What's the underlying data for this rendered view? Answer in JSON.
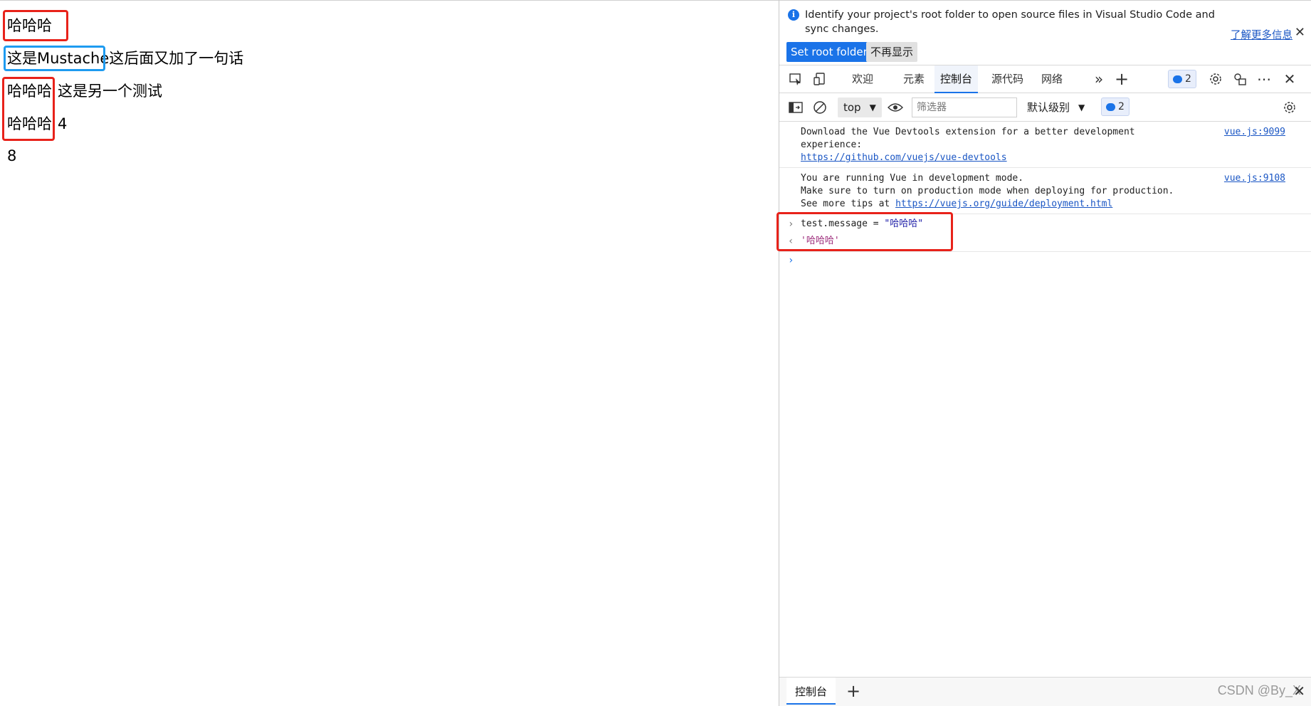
{
  "page": {
    "lines": [
      {
        "text": "哈哈哈"
      },
      {
        "prefix": "这是Mustache",
        "suffix": "这后面又加了一句话"
      },
      {
        "prefix": "哈哈哈",
        "suffix": "这是另一个测试"
      },
      {
        "prefix": "哈哈哈",
        "suffix": "4"
      },
      {
        "text": "8"
      }
    ]
  },
  "devtools": {
    "infobar": {
      "text": "Identify your project's root folder to open source files in Visual Studio Code and sync changes.",
      "learn_more": "了解更多信息",
      "set_root": "Set root folder",
      "dont_show": "不再显示"
    },
    "tabs": [
      "欢迎",
      "元素",
      "控制台",
      "源代码",
      "网络"
    ],
    "issues_count": "2",
    "filterbar": {
      "context": "top",
      "filter_placeholder": "筛选器",
      "level": "默认级别",
      "issues_count": "2"
    },
    "console": {
      "messages": [
        {
          "lines": [
            "Download the Vue Devtools extension for a better development",
            "experience:"
          ],
          "link": "https://github.com/vuejs/vue-devtools",
          "source": "vue.js:9099"
        },
        {
          "lines": [
            "You are running Vue in development mode.",
            "Make sure to turn on production mode when deploying for production."
          ],
          "prefix": "See more tips at ",
          "link": "https://vuejs.org/guide/deployment.html",
          "source": "vue.js:9108"
        }
      ],
      "input_code": "test.message = ",
      "input_string": "\"哈哈哈\"",
      "result": "'哈哈哈'"
    },
    "drawer_tab": "控制台",
    "watermark": "CSDN @By_X"
  },
  "colors": {
    "highlight_red": "#e8221a",
    "highlight_blue": "#1e9bf0",
    "accent": "#1a73e8"
  }
}
